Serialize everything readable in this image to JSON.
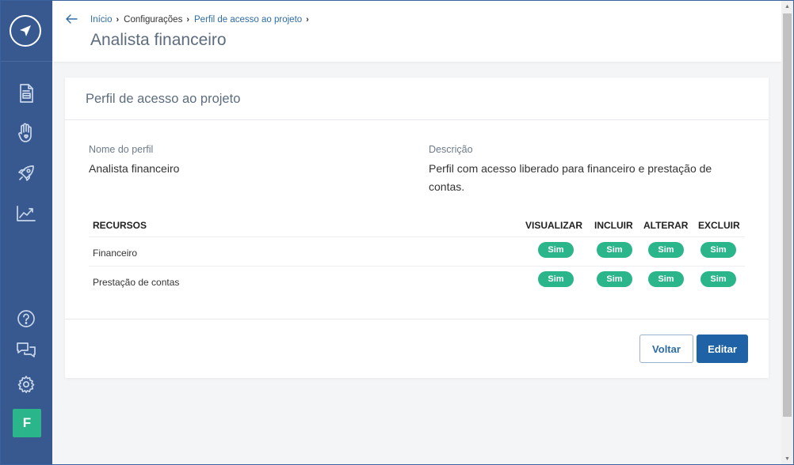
{
  "sidebar": {
    "nav_icons": [
      "document-icon",
      "hand-heart-icon",
      "rocket-icon",
      "chart-trend-icon"
    ],
    "bottom_icons": [
      "help-icon",
      "chat-icon",
      "gear-icon"
    ],
    "avatar_letter": "F"
  },
  "header": {
    "breadcrumb": {
      "home": "Início",
      "settings": "Configurações",
      "current": "Perfil de acesso ao projeto"
    },
    "title": "Analista financeiro"
  },
  "card": {
    "title": "Perfil de acesso ao projeto",
    "name_label": "Nome do perfil",
    "name_value": "Analista financeiro",
    "description_label": "Descrição",
    "description_value": "Perfil com acesso liberado para financeiro e prestação de contas."
  },
  "permissions": {
    "headers": {
      "resources": "RECURSOS",
      "view": "VISUALIZAR",
      "include": "INCLUIR",
      "change": "ALTERAR",
      "delete": "EXCLUIR"
    },
    "rows": [
      {
        "name": "Financeiro",
        "view": "Sim",
        "include": "Sim",
        "change": "Sim",
        "delete": "Sim"
      },
      {
        "name": "Prestação de contas",
        "view": "Sim",
        "include": "Sim",
        "change": "Sim",
        "delete": "Sim"
      }
    ]
  },
  "actions": {
    "back_label": "Voltar",
    "edit_label": "Editar"
  },
  "colors": {
    "sidebar": "#37598f",
    "accent": "#1f63a6",
    "badge": "#2ab58b"
  }
}
